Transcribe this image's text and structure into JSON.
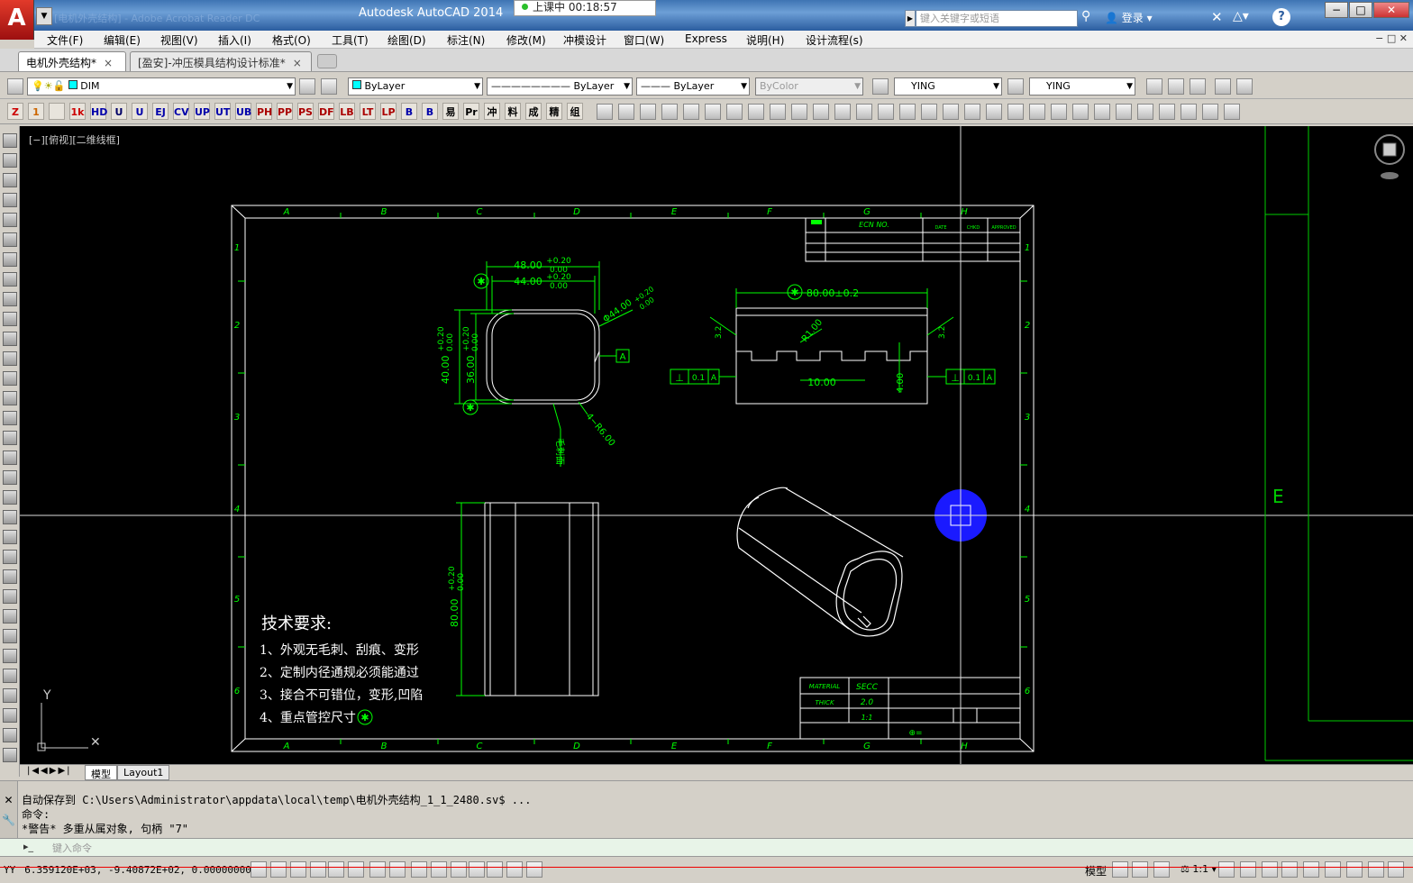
{
  "window": {
    "app_logo": "A",
    "title": "Autodesk AutoCAD 2014",
    "ghost_title": "[电机外壳结构] - Adobe Acrobat Reader DC",
    "timer": "上课中 00:18:57",
    "search_placeholder": "键入关键字或短语",
    "login": "登录",
    "help": "?"
  },
  "menu": [
    "文件(F)",
    "编辑(E)",
    "视图(V)",
    "插入(I)",
    "格式(O)",
    "工具(T)",
    "绘图(D)",
    "标注(N)",
    "修改(M)",
    "冲模设计",
    "窗口(W)",
    "Express",
    "说明(H)",
    "设计流程(s)"
  ],
  "doc_tabs": [
    {
      "label": "电机外壳结构*",
      "close": "×",
      "active": true
    },
    {
      "label": "[盈安]-冲压模具结构设计标准*",
      "close": "×",
      "active": false
    }
  ],
  "toolbar1": {
    "layer": "DIM",
    "color": "ByLayer",
    "linetype": "ByLayer",
    "lineweight": "ByLayer",
    "plotstyle": "ByColor",
    "textstyle": "YING",
    "dimstyle": "YING"
  },
  "toolbar2_icons": [
    "Z",
    "1",
    "",
    "1k",
    "HD",
    "U",
    "U",
    "EJ",
    "CV",
    "UP",
    "UT",
    "UB",
    "PH",
    "PP",
    "PS",
    "DF",
    "LB",
    "LT",
    "LP",
    "B",
    "B",
    "易",
    "Pr",
    "冲",
    "料",
    "成",
    "精",
    "组"
  ],
  "drawing": {
    "view_label": "[−][俯视][二维线框]",
    "grid_letters": [
      "A",
      "B",
      "C",
      "D",
      "E",
      "F",
      "G",
      "H"
    ],
    "grid_numbers": [
      "1",
      "2",
      "3",
      "4",
      "5",
      "6"
    ],
    "title_block": {
      "ecn": "ECN NO.",
      "date": "DATE",
      "chkd": "CHKD",
      "approved": "APPROVED"
    },
    "material_label": "MATERIAL",
    "material": "SECC",
    "thick_label": "THICK",
    "thick": "2.0",
    "scale": "1:1",
    "dims": {
      "d48": "48.00",
      "tol48a": "+0.20",
      "tol48b": "0.00",
      "d44": "44.00",
      "tol44a": "+0.20",
      "tol44b": "0.00",
      "phi44": "Φ44.00",
      "tol_phi": "+0.20",
      "tol_phi_b": "0.00",
      "d40": "40.00",
      "d36": "36.00",
      "tol40": "+0.20",
      "tol40b": "0.00",
      "datum": "A",
      "r6": "4−R6.00",
      "burr": "毛刺面",
      "d80": "80.00±0.2",
      "r1": "R1.00",
      "d10": "10.00",
      "d4": "4.00",
      "d3a": "3.2",
      "d3b": "3.2",
      "flat": "0.1",
      "d80v": "80.00",
      "tol80a": "+0.20",
      "tol80b": "0.00"
    },
    "notes_title": "技术要求:",
    "notes": [
      "1、外观无毛刺、刮痕、变形",
      "2、定制内径通规必须能通过",
      "3、接合不可错位，变形,凹陷",
      "4、重点管控尺寸"
    ],
    "ucs_y": "Y",
    "right_label": "E"
  },
  "layout_tabs": [
    "模型",
    "Layout1"
  ],
  "command": {
    "lines": [
      "自动保存到 C:\\Users\\Administrator\\appdata\\local\\temp\\电机外壳结构_1_1_2480.sv$ ...",
      "命令:",
      " *警告* 多重从属对象, 句柄 \"7\""
    ],
    "placeholder": "键入命令"
  },
  "status": {
    "coords": "6.359120E+03, -9.40872E+02, 0.00000000",
    "model": "模型",
    "scale": "1:1"
  },
  "colors": {
    "canvas": "#000000",
    "drawing_line": "#ffffff",
    "dimension": "#00ff00",
    "frame_line": "#00c000",
    "highlight": "#1a1aff"
  }
}
